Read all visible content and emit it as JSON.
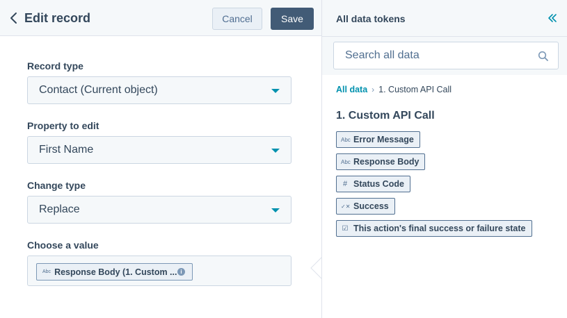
{
  "editor": {
    "title": "Edit record",
    "back_icon": "chevron-left-icon",
    "cancel_label": "Cancel",
    "save_label": "Save"
  },
  "fields": {
    "record_type": {
      "label": "Record type",
      "value": "Contact (Current object)"
    },
    "property": {
      "label": "Property to edit",
      "value": "First Name"
    },
    "change_type": {
      "label": "Change type",
      "value": "Replace"
    },
    "choose_value": {
      "label": "Choose a value",
      "chip_type": "Abc",
      "chip_text": "Response Body (1. Custom ...",
      "info_glyph": "i"
    }
  },
  "tokens_panel": {
    "title": "All data tokens",
    "collapse_icon": "double-chevron-left-icon",
    "search_placeholder": "Search all data",
    "breadcrumb": {
      "root": "All data",
      "separator": "›",
      "current": "1. Custom API Call"
    },
    "section_title": "1. Custom API Call",
    "tokens": [
      {
        "icon": "Abc",
        "label": "Error Message"
      },
      {
        "icon": "Abc",
        "label": "Response Body"
      },
      {
        "icon": "#",
        "label": "Status Code"
      },
      {
        "icon": "✓✕",
        "label": "Success"
      },
      {
        "icon": "☑",
        "label": "This action's final success or failure state"
      }
    ]
  },
  "colors": {
    "accent": "#0091ae",
    "primary_button": "#425b76",
    "text": "#33475b",
    "border": "#cbd6e2",
    "surface": "#f5f8fa"
  }
}
